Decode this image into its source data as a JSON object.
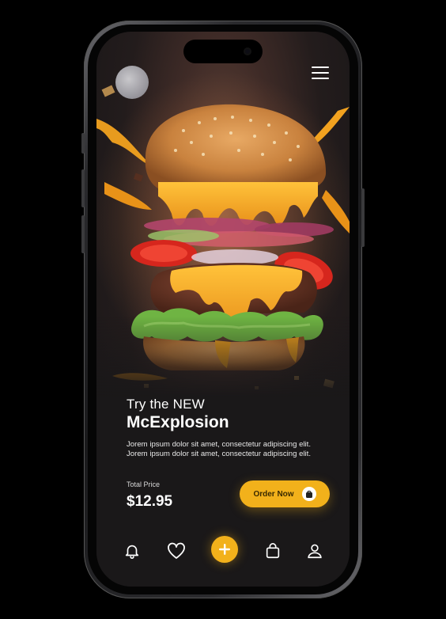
{
  "hero": {
    "headline": "Try the NEW",
    "product_name": "McExplosion",
    "description": "Jorem ipsum dolor sit amet, consectetur adipiscing elit. Jorem ipsum dolor sit amet, consectetur adipiscing elit."
  },
  "pricing": {
    "label": "Total Price",
    "value": "$12.95"
  },
  "order_button": {
    "label": "Order Now",
    "icon": "shopping-bag-icon"
  },
  "top_bar": {
    "logo": "brand-logo",
    "menu_icon": "hamburger-menu-icon"
  },
  "bottom_nav": {
    "items": [
      {
        "icon": "bell-icon"
      },
      {
        "icon": "heart-icon"
      },
      {
        "icon": "plus-icon"
      },
      {
        "icon": "shopping-bag-icon"
      },
      {
        "icon": "user-icon"
      }
    ]
  },
  "colors": {
    "accent": "#f2b11b",
    "background": "#1a1819",
    "text": "#ffffff"
  }
}
